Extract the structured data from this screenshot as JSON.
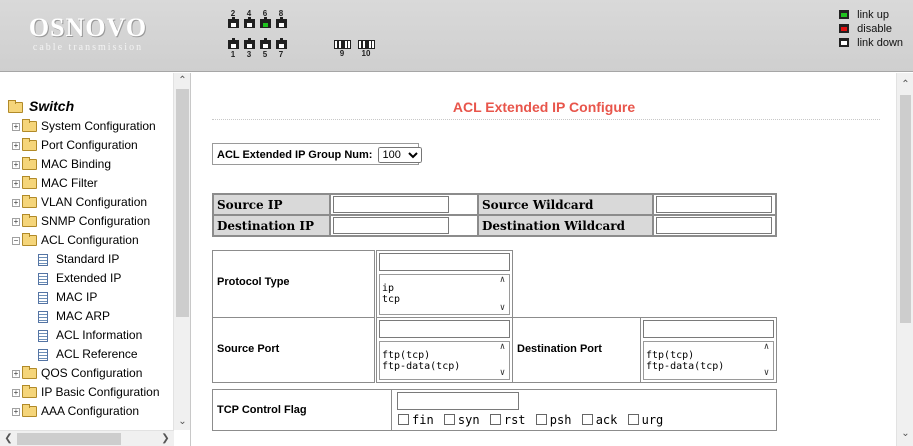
{
  "header": {
    "logo": {
      "name": "OSNOVO",
      "tagline": "cable transmission"
    },
    "ports_top": [
      "2",
      "4",
      "6",
      "8"
    ],
    "ports_bottom": [
      "1",
      "3",
      "5",
      "7"
    ],
    "sfp_ports": [
      "9",
      "10"
    ],
    "port_status_up": [
      "6"
    ],
    "legend": [
      {
        "label": "link up",
        "color": "#1fc41f"
      },
      {
        "label": "disable",
        "color": "#e01010"
      },
      {
        "label": "link down",
        "color": "#ffffff"
      }
    ]
  },
  "sidebar": {
    "root": "Switch",
    "items": [
      {
        "label": "System Configuration",
        "expanded": false
      },
      {
        "label": "Port Configuration",
        "expanded": false
      },
      {
        "label": "MAC Binding",
        "expanded": false
      },
      {
        "label": "MAC Filter",
        "expanded": false
      },
      {
        "label": "VLAN Configuration",
        "expanded": false
      },
      {
        "label": "SNMP Configuration",
        "expanded": false
      },
      {
        "label": "ACL Configuration",
        "expanded": true
      },
      {
        "label": "Standard IP",
        "child": true
      },
      {
        "label": "Extended IP",
        "child": true
      },
      {
        "label": "MAC IP",
        "child": true
      },
      {
        "label": "MAC ARP",
        "child": true
      },
      {
        "label": "ACL Information",
        "child": true
      },
      {
        "label": "ACL Reference",
        "child": true
      },
      {
        "label": "QOS Configuration",
        "expanded": false
      },
      {
        "label": "IP Basic Configuration",
        "expanded": false
      },
      {
        "label": "AAA Configuration",
        "expanded": false
      }
    ]
  },
  "main": {
    "title": "ACL Extended IP Configure",
    "group_num_label": "ACL Extended IP Group Num:",
    "group_num_value": "100",
    "source_ip_label": "Source IP",
    "source_ip_value": "",
    "source_wildcard_label": "Source Wildcard",
    "source_wildcard_value": "",
    "destination_ip_label": "Destination IP",
    "destination_ip_value": "",
    "destination_wildcard_label": "Destination Wildcard",
    "destination_wildcard_value": "",
    "protocol_type_label": "Protocol Type",
    "protocol_options": [
      "ip",
      "tcp"
    ],
    "source_port_label": "Source Port",
    "source_port_options": [
      "ftp(tcp)",
      "ftp-data(tcp)"
    ],
    "destination_port_label": "Destination Port",
    "destination_port_options": [
      "ftp(tcp)",
      "ftp-data(tcp)"
    ],
    "tcp_flag_label": "TCP Control Flag",
    "tcp_flags": [
      "fin",
      "syn",
      "rst",
      "psh",
      "ack",
      "urg"
    ]
  },
  "colors": {
    "title": "#e8554b",
    "label_bg": "#d9d9d9",
    "link_up": "#1fc41f",
    "disable": "#e01010"
  },
  "icons": {
    "folder": "folder-icon",
    "page": "page-icon",
    "expand": "plus-box-icon",
    "collapse": "minus-box-icon"
  }
}
